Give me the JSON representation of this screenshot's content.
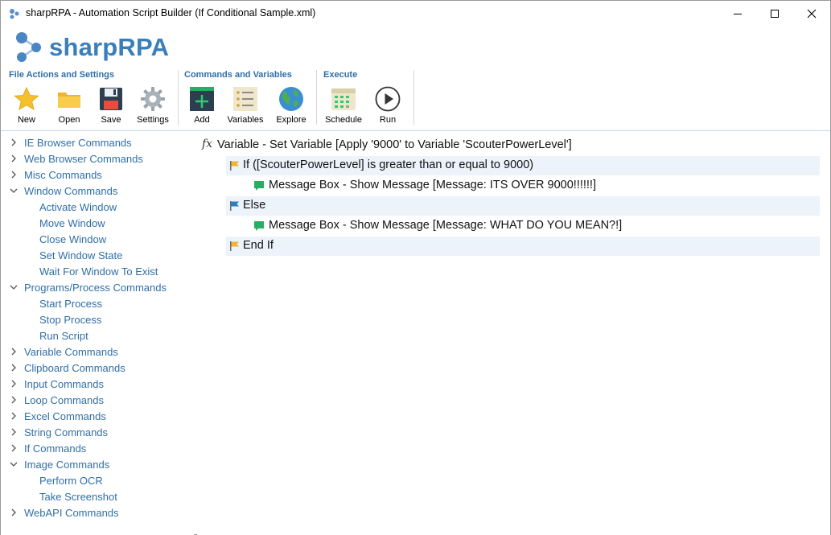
{
  "window": {
    "title": "sharpRPA - Automation Script Builder (If Conditional Sample.xml)"
  },
  "brand": {
    "name": "sharpRPA"
  },
  "ribbon": {
    "groups": [
      {
        "title": "File Actions and Settings",
        "buttons": [
          {
            "label": "New",
            "icon": "star-icon"
          },
          {
            "label": "Open",
            "icon": "folder-icon"
          },
          {
            "label": "Save",
            "icon": "floppy-disk-icon"
          },
          {
            "label": "Settings",
            "icon": "gear-icon"
          }
        ]
      },
      {
        "title": "Commands and Variables",
        "buttons": [
          {
            "label": "Add",
            "icon": "add-command-icon"
          },
          {
            "label": "Variables",
            "icon": "variable-list-icon"
          },
          {
            "label": "Explore",
            "icon": "globe-icon"
          }
        ]
      },
      {
        "title": "Execute",
        "buttons": [
          {
            "label": "Schedule",
            "icon": "calendar-icon"
          },
          {
            "label": "Run",
            "icon": "play-icon"
          }
        ]
      }
    ]
  },
  "sidebar": {
    "items": [
      {
        "label": "IE Browser Commands",
        "expanded": false,
        "child": false
      },
      {
        "label": "Web Browser Commands",
        "expanded": false,
        "child": false
      },
      {
        "label": "Misc Commands",
        "expanded": false,
        "child": false
      },
      {
        "label": "Window Commands",
        "expanded": true,
        "child": false
      },
      {
        "label": "Activate Window",
        "child": true
      },
      {
        "label": "Move Window",
        "child": true
      },
      {
        "label": "Close Window",
        "child": true
      },
      {
        "label": "Set Window State",
        "child": true
      },
      {
        "label": "Wait For Window To Exist",
        "child": true
      },
      {
        "label": "Programs/Process Commands",
        "expanded": true,
        "child": false
      },
      {
        "label": "Start Process",
        "child": true
      },
      {
        "label": "Stop Process",
        "child": true
      },
      {
        "label": "Run Script",
        "child": true
      },
      {
        "label": "Variable Commands",
        "expanded": false,
        "child": false
      },
      {
        "label": "Clipboard Commands",
        "expanded": false,
        "child": false
      },
      {
        "label": "Input Commands",
        "expanded": false,
        "child": false
      },
      {
        "label": "Loop Commands",
        "expanded": false,
        "child": false
      },
      {
        "label": "Excel Commands",
        "expanded": false,
        "child": false
      },
      {
        "label": "String Commands",
        "expanded": false,
        "child": false
      },
      {
        "label": "If Commands",
        "expanded": false,
        "child": false
      },
      {
        "label": "Image Commands",
        "expanded": true,
        "child": false
      },
      {
        "label": "Perform OCR",
        "child": true
      },
      {
        "label": "Take Screenshot",
        "child": true
      },
      {
        "label": "WebAPI Commands",
        "expanded": false,
        "child": false
      }
    ]
  },
  "script": {
    "fx_symbol": "fx",
    "commands": [
      {
        "text": "Variable - Set Variable [Apply '9000' to Variable 'ScouterPowerLevel']",
        "icon": "function-icon",
        "indent": 0,
        "highlight": false
      },
      {
        "text": "If ([ScouterPowerLevel] is greater than or equal to 9000)",
        "icon": "yellow-flag-icon",
        "indent": 1,
        "highlight": true
      },
      {
        "text": "Message Box - Show Message [Message: ITS OVER 9000!!!!!!]",
        "icon": "message-icon",
        "indent": 2,
        "highlight": false
      },
      {
        "text": "Else",
        "icon": "blue-flag-icon",
        "indent": 1,
        "highlight": true
      },
      {
        "text": "Message Box - Show Message [Message: WHAT DO YOU MEAN?!]",
        "icon": "message-icon",
        "indent": 2,
        "highlight": false
      },
      {
        "text": "End If",
        "icon": "yellow-flag-icon",
        "indent": 1,
        "highlight": true
      }
    ]
  },
  "colors": {
    "accent": "#3a7fb9",
    "group_title": "#2f6fa8",
    "tree_text": "#2f6fa8",
    "row_highlight": "#ecf3fa"
  }
}
